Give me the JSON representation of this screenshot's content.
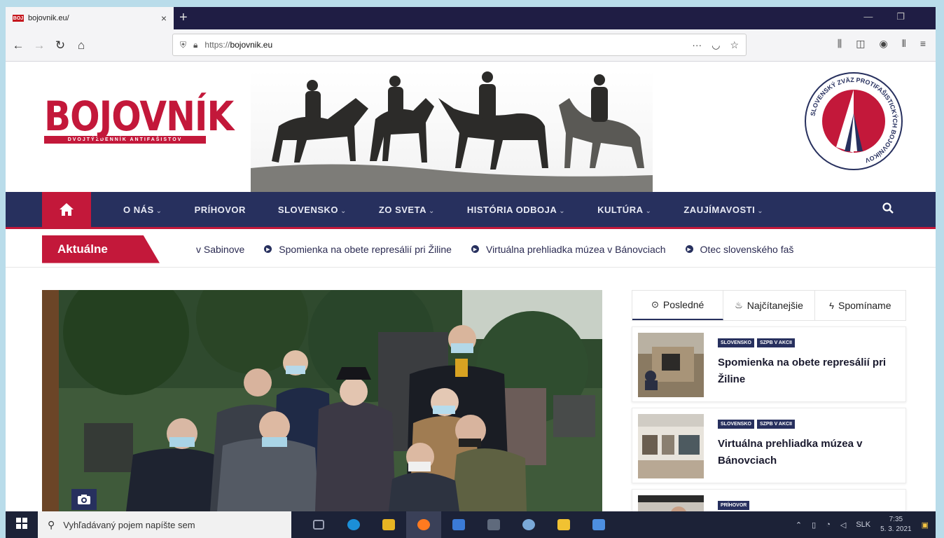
{
  "browser": {
    "tab_title": "bojovnik.eu/",
    "tab_close": "×",
    "new_tab": "+",
    "url_prefix": "https://",
    "url_domain": "bojovnik.eu",
    "url_more": "···"
  },
  "site": {
    "logo_name": "BOJOVNÍK",
    "logo_tagline": "DVOJTÝŽDENNÍK ANTIFAŠISTOV",
    "emblem_text": "SLOVENSKÝ ZVÄZ PROTIFAŠISTICKÝCH BOJOVNÍKOV",
    "brand_red": "#c3183a",
    "brand_navy": "#27305e"
  },
  "menu": {
    "items": [
      {
        "label": "O NÁS",
        "dropdown": true
      },
      {
        "label": "PRÍHOVOR",
        "dropdown": false
      },
      {
        "label": "SLOVENSKO",
        "dropdown": true
      },
      {
        "label": "ZO SVETA",
        "dropdown": true
      },
      {
        "label": "HISTÓRIA ODBOJA",
        "dropdown": true
      },
      {
        "label": "KULTÚRA",
        "dropdown": true
      },
      {
        "label": "ZAUJÍMAVOSTI",
        "dropdown": true
      }
    ],
    "caret": "⌄"
  },
  "ticker": {
    "label": "Aktuálne",
    "items": [
      "v Sabinove",
      "Spomienka na obete represálií pri Žiline",
      "Virtuálna prehliadka múzea v Bánovciach",
      "Otec slovenského faš"
    ]
  },
  "sidebar": {
    "tabs": [
      {
        "label": "Posledné",
        "icon": "clock-icon"
      },
      {
        "label": "Najčítanejšie",
        "icon": "flame-icon"
      },
      {
        "label": "Spomíname",
        "icon": "bolt-icon"
      }
    ],
    "posts": [
      {
        "tags": [
          "SLOVENSKO",
          "SZPB V AKCII"
        ],
        "title": "Spomienka na obete represálií pri Žiline"
      },
      {
        "tags": [
          "SLOVENSKO",
          "SZPB V AKCII"
        ],
        "title": "Virtuálna prehliadka múzea v Bánovciach"
      },
      {
        "tags": [
          "PRÍHOVOR"
        ],
        "title": ""
      }
    ]
  },
  "taskbar": {
    "search_placeholder": "Vyhľadávaný pojem napíšte sem",
    "language": "SLK",
    "time": "7:35",
    "date": "5. 3. 2021"
  }
}
